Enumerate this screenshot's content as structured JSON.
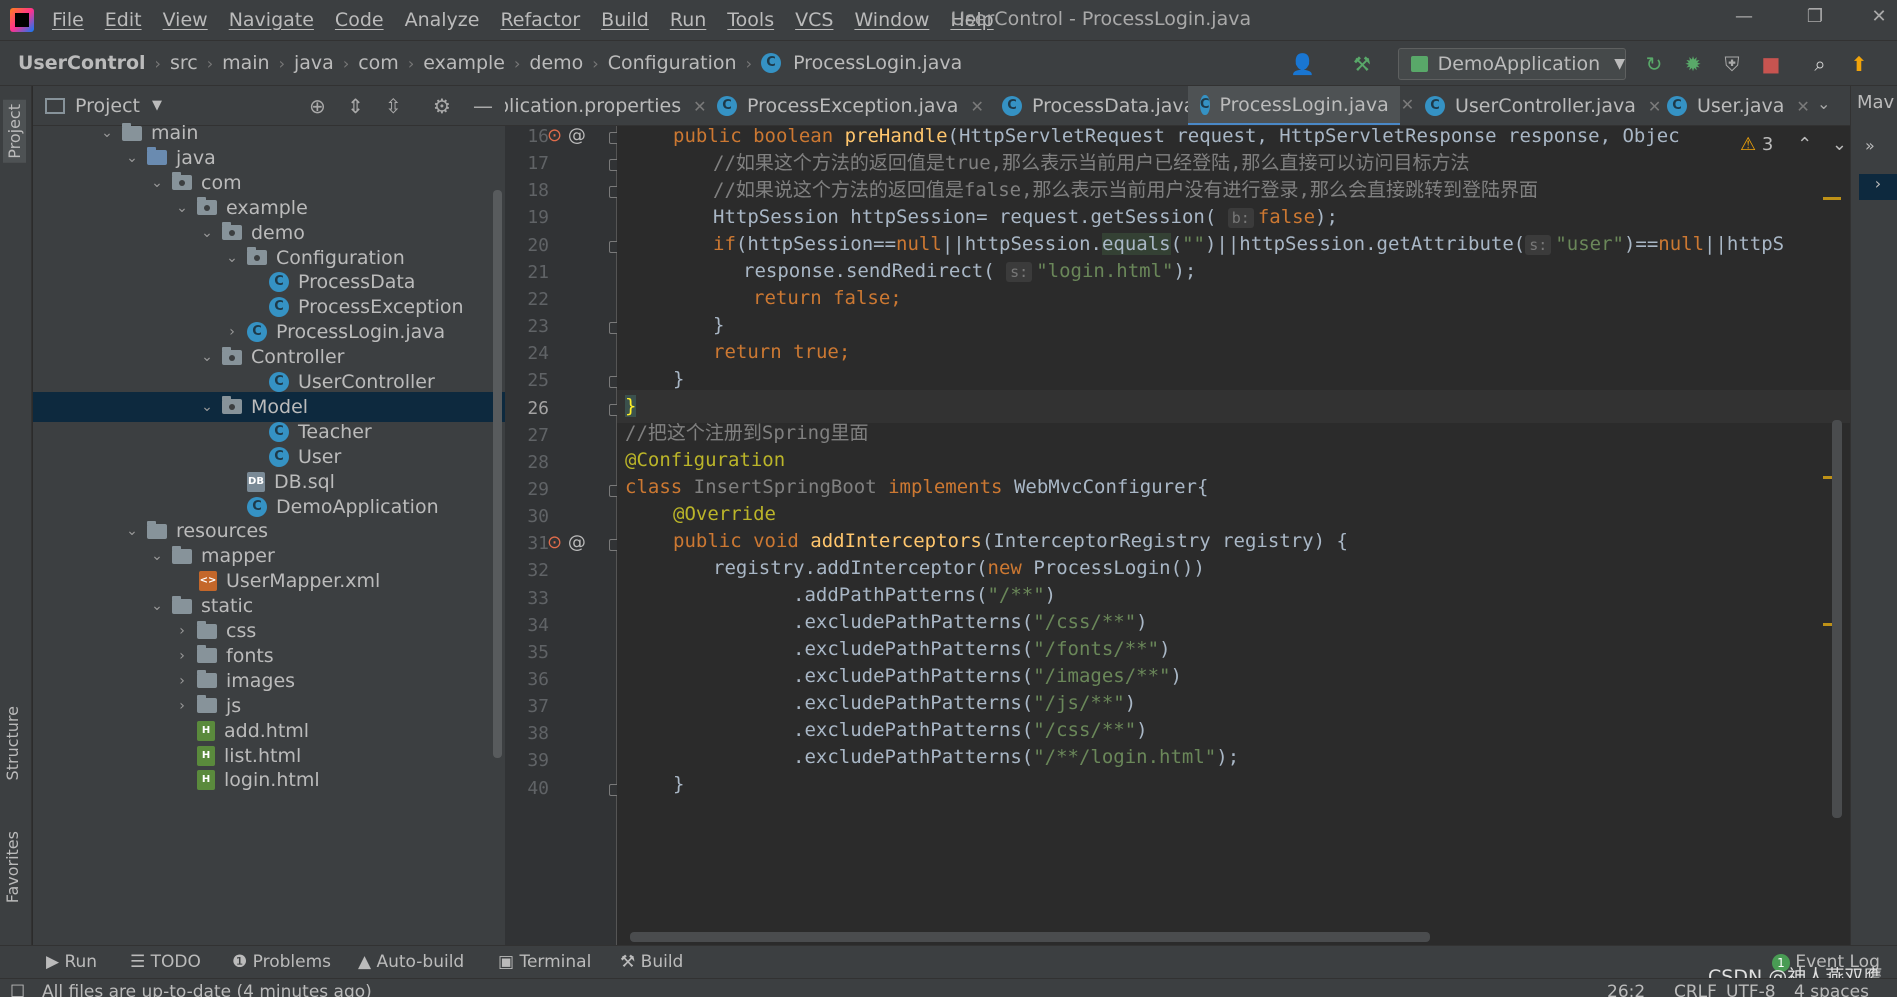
{
  "menu": {
    "items": [
      "File",
      "Edit",
      "View",
      "Navigate",
      "Code",
      "Analyze",
      "Refactor",
      "Build",
      "Run",
      "Tools",
      "VCS",
      "Window",
      "Help"
    ],
    "window_title": "UserControl - ProcessLogin.java"
  },
  "window_controls": {
    "minimize": "—",
    "restore": "❐",
    "close": "✕"
  },
  "breadcrumb": [
    "UserControl",
    "src",
    "main",
    "java",
    "com",
    "example",
    "demo",
    "Configuration",
    "ProcessLogin.java"
  ],
  "run_config": {
    "label": "DemoApplication",
    "icon": "spring-app-icon"
  },
  "project": {
    "title": "Project",
    "tree": [
      {
        "label": "main",
        "type": "folder",
        "arrow": "⌄"
      },
      {
        "label": "java",
        "type": "folder-src",
        "arrow": "⌄"
      },
      {
        "label": "com",
        "type": "package",
        "arrow": "⌄"
      },
      {
        "label": "example",
        "type": "package",
        "arrow": "⌄"
      },
      {
        "label": "demo",
        "type": "package",
        "arrow": "⌄"
      },
      {
        "label": "Configuration",
        "type": "package",
        "arrow": "⌄"
      },
      {
        "label": "ProcessData",
        "type": "class",
        "arrow": ""
      },
      {
        "label": "ProcessException",
        "type": "class",
        "arrow": ""
      },
      {
        "label": "ProcessLogin.java",
        "type": "class",
        "arrow": "›"
      },
      {
        "label": "Controller",
        "type": "package",
        "arrow": "⌄"
      },
      {
        "label": "UserController",
        "type": "class",
        "arrow": ""
      },
      {
        "label": "Model",
        "type": "package",
        "arrow": "⌄"
      },
      {
        "label": "Teacher",
        "type": "class",
        "arrow": ""
      },
      {
        "label": "User",
        "type": "class",
        "arrow": ""
      },
      {
        "label": "DB.sql",
        "type": "sql",
        "arrow": ""
      },
      {
        "label": "DemoApplication",
        "type": "class",
        "arrow": ""
      },
      {
        "label": "resources",
        "type": "folder",
        "arrow": "⌄"
      },
      {
        "label": "mapper",
        "type": "folder",
        "arrow": "⌄"
      },
      {
        "label": "UserMapper.xml",
        "type": "xml",
        "arrow": ""
      },
      {
        "label": "static",
        "type": "folder",
        "arrow": "⌄"
      },
      {
        "label": "css",
        "type": "folder",
        "arrow": "›"
      },
      {
        "label": "fonts",
        "type": "folder",
        "arrow": "›"
      },
      {
        "label": "images",
        "type": "folder",
        "arrow": "›"
      },
      {
        "label": "js",
        "type": "folder",
        "arrow": "›"
      },
      {
        "label": "add.html",
        "type": "html",
        "arrow": ""
      },
      {
        "label": "list.html",
        "type": "html",
        "arrow": ""
      },
      {
        "label": "login.html",
        "type": "html",
        "arrow": ""
      }
    ],
    "selected": "Model"
  },
  "tabs": [
    {
      "label": "plication.properties",
      "active": false
    },
    {
      "label": "ProcessException.java",
      "active": false
    },
    {
      "label": "ProcessData.java",
      "active": false
    },
    {
      "label": "ProcessLogin.java",
      "active": true
    },
    {
      "label": "UserController.java",
      "active": false
    },
    {
      "label": "User.java",
      "active": false
    }
  ],
  "tab_overflow": "Mav",
  "warnings": {
    "count": "3",
    "icon": "warning-icon"
  },
  "editor": {
    "current_line": 26,
    "lines": [
      {
        "n": "16"
      },
      {
        "n": "17"
      },
      {
        "n": "18"
      },
      {
        "n": "19"
      },
      {
        "n": "20"
      },
      {
        "n": "21"
      },
      {
        "n": "22"
      },
      {
        "n": "23"
      },
      {
        "n": "24"
      },
      {
        "n": "25"
      },
      {
        "n": "26"
      },
      {
        "n": "27"
      },
      {
        "n": "28"
      },
      {
        "n": "29"
      },
      {
        "n": "30"
      },
      {
        "n": "31"
      },
      {
        "n": "32"
      },
      {
        "n": "33"
      },
      {
        "n": "34"
      },
      {
        "n": "35"
      },
      {
        "n": "36"
      },
      {
        "n": "37"
      },
      {
        "n": "38"
      },
      {
        "n": "39"
      },
      {
        "n": "40"
      }
    ],
    "code": {
      "l16": [
        "public boolean ",
        "preHandle",
        "(HttpServletRequest request, HttpServletResponse response, Objec"
      ],
      "l17": "//如果这个方法的返回值是true,那么表示当前用户已经登陆,那么直接可以访问目标方法",
      "l18": "//如果说这个方法的返回值是false,那么表示当前用户没有进行登录,那么会直接跳转到登陆界面",
      "l19": [
        "HttpSession httpSession= request.getSession(",
        "b:",
        "false",
        ");"
      ],
      "l20": [
        "if",
        "(httpSession==",
        "null",
        "||httpSession.",
        "equals",
        "(",
        "\"\"",
        ")||httpSession.getAttribute(",
        "s:",
        "\"user\"",
        ")==",
        "null",
        "||httpS"
      ],
      "l21": [
        "response.sendRedirect(",
        "s:",
        "\"login.html\"",
        ");"
      ],
      "l22": [
        "return false",
        ";"
      ],
      "l23": "}",
      "l24": [
        "return true",
        ";"
      ],
      "l25": "}",
      "l26": "}",
      "l27": "//把这个注册到Spring里面",
      "l28": "@Configuration",
      "l29": [
        "class ",
        "InsertSpringBoot",
        " implements ",
        "WebMvcConfigurer{"
      ],
      "l30": "@Override",
      "l31": [
        "public void ",
        "addInterceptors",
        "(InterceptorRegistry registry) {"
      ],
      "l32": [
        "registry.addInterceptor(",
        "new ",
        "ProcessLogin())"
      ],
      "l33": [
        ".addPathPatterns(",
        "\"/**\"",
        ")"
      ],
      "l34": [
        ".excludePathPatterns(",
        "\"/css/**\"",
        ")"
      ],
      "l35": [
        ".excludePathPatterns(",
        "\"/fonts/**\"",
        ")"
      ],
      "l36": [
        ".excludePathPatterns(",
        "\"/images/**\"",
        ")"
      ],
      "l37": [
        ".excludePathPatterns(",
        "\"/js/**\"",
        ")"
      ],
      "l38": [
        ".excludePathPatterns(",
        "\"/css/**\"",
        ")"
      ],
      "l39": [
        ".excludePathPatterns(",
        "\"/**/login.html\"",
        ");"
      ],
      "l40": "}"
    }
  },
  "left_strip": {
    "project": "Project",
    "structure": "Structure",
    "favorites": "Favorites"
  },
  "bottom_tools": [
    {
      "label": "Run",
      "icon": "play-icon"
    },
    {
      "label": "TODO",
      "icon": "list-icon"
    },
    {
      "label": "Problems",
      "icon": "info-icon"
    },
    {
      "label": "Auto-build",
      "icon": "warning-icon"
    },
    {
      "label": "Terminal",
      "icon": "terminal-icon"
    },
    {
      "label": "Build",
      "icon": "hammer-icon"
    }
  ],
  "event_log": {
    "label": "Event Log",
    "badge": "1"
  },
  "status": {
    "message": "All files are up-to-date (4 minutes ago)",
    "position": "26:2",
    "line_sep": "CRLF",
    "encoding": "UTF-8",
    "indent": "4 spaces"
  },
  "watermark": "CSDN @神人燕双鹰",
  "colors": {
    "accent": "#4a88c7",
    "keyword": "#cc7832",
    "string": "#6a8759",
    "function": "#ffc66d",
    "annotation": "#bbb529"
  }
}
